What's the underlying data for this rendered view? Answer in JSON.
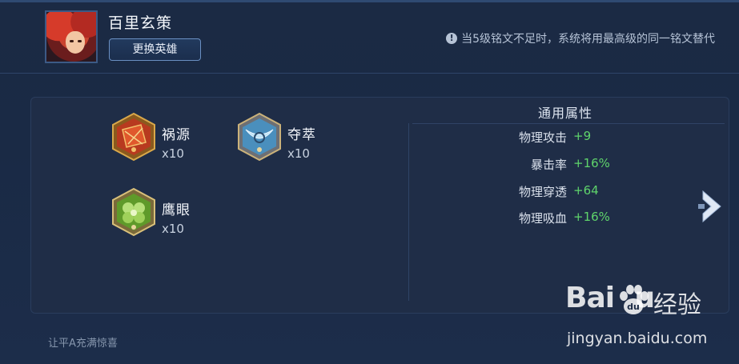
{
  "hero": {
    "name": "百里玄策",
    "change_button": "更换英雄"
  },
  "notice": {
    "icon": "info-icon",
    "text": "当5级铭文不足时，系统将用最高级的同一铭文替代"
  },
  "runes": [
    {
      "name": "祸源",
      "count": "x10",
      "icon": "red-rune-icon",
      "color": "#c8452a"
    },
    {
      "name": "夺萃",
      "count": "x10",
      "icon": "blue-rune-icon",
      "color": "#7fb8de"
    },
    {
      "name": "鹰眼",
      "count": "x10",
      "icon": "green-rune-icon",
      "color": "#7fbf3a"
    }
  ],
  "attributes": {
    "title": "通用属性",
    "items": [
      {
        "name": "物理攻击",
        "value": "+9"
      },
      {
        "name": "暴击率",
        "value": "+16%"
      },
      {
        "name": "物理穿透",
        "value": "+64"
      },
      {
        "name": "物理吸血",
        "value": "+16%"
      }
    ]
  },
  "footer": {
    "tip": "让平A充满惊喜"
  },
  "watermark": {
    "brand": "Baidu",
    "product": "经验",
    "url": "jingyan.baidu.com"
  },
  "colors": {
    "accent_green": "#5fd46b",
    "background": "#1b2a44",
    "panel": "#1f2d47"
  }
}
